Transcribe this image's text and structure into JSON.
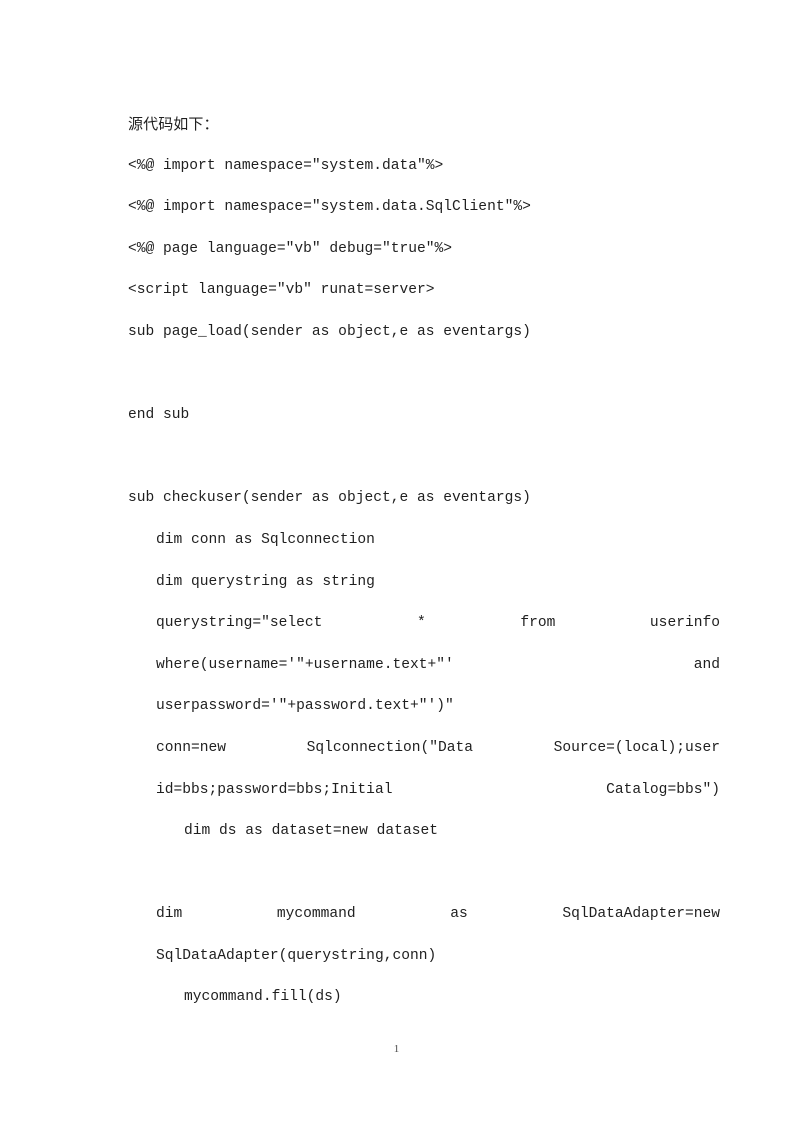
{
  "document": {
    "heading": "源代码如下：",
    "page_number": "1",
    "lines": [
      {
        "id": "line-import-data",
        "text": "<%@ import namespace=\"system.data\"%>",
        "indent": 0,
        "justify": "normal",
        "blank": false
      },
      {
        "id": "line-import-sqlclient",
        "text": "<%@ import namespace=\"system.data.SqlClient\"%>",
        "indent": 0,
        "justify": "normal",
        "blank": false
      },
      {
        "id": "line-page-directive",
        "text": "<%@ page language=\"vb\" debug=\"true\"%>",
        "indent": 0,
        "justify": "normal",
        "blank": false
      },
      {
        "id": "line-script-open",
        "text": "<script language=\"vb\" runat=server>",
        "indent": 0,
        "justify": "normal",
        "blank": false
      },
      {
        "id": "line-sub-page-load",
        "text": "sub page_load(sender as object,e as eventargs)",
        "indent": 0,
        "justify": "normal",
        "blank": false
      },
      {
        "id": "line-blank-1",
        "text": "",
        "indent": 0,
        "justify": "normal",
        "blank": true
      },
      {
        "id": "line-end-sub-1",
        "text": "end sub",
        "indent": 0,
        "justify": "normal",
        "blank": false
      },
      {
        "id": "line-blank-2",
        "text": "",
        "indent": 0,
        "justify": "normal",
        "blank": true
      },
      {
        "id": "line-sub-checkuser",
        "text": "sub checkuser(sender as object,e as eventargs)",
        "indent": 0,
        "justify": "normal",
        "blank": false
      },
      {
        "id": "line-dim-conn",
        "text": "dim conn as Sqlconnection",
        "indent": 1,
        "justify": "left",
        "blank": false
      },
      {
        "id": "line-dim-querystring",
        "text": "dim querystring as string",
        "indent": 1,
        "justify": "left",
        "blank": false
      },
      {
        "id": "line-querystring-assign",
        "text": "querystring=\"select * from userinfo where(username='\"+username.text+\"' and userpassword='\"+password.text+\"')\"",
        "indent": 1,
        "justify": "all",
        "blank": false
      },
      {
        "id": "line-conn-new",
        "text": "conn=new Sqlconnection(\"Data Source=(local);user id=bbs;password=bbs;Initial Catalog=bbs\")",
        "indent": 1,
        "justify": "all",
        "blank": false
      },
      {
        "id": "line-dim-ds",
        "text": "dim ds as dataset=new dataset",
        "indent": 2,
        "justify": "left",
        "blank": false
      },
      {
        "id": "line-blank-3",
        "text": "",
        "indent": 0,
        "justify": "normal",
        "blank": true
      },
      {
        "id": "line-dim-mycommand",
        "text": "dim mycommand as SqlDataAdapter=new SqlDataAdapter(querystring,conn)",
        "indent": 1,
        "justify": "all",
        "blank": false
      },
      {
        "id": "line-mycommand-fill",
        "text": "mycommand.fill(ds)",
        "indent": 2,
        "justify": "left",
        "blank": false
      }
    ]
  }
}
